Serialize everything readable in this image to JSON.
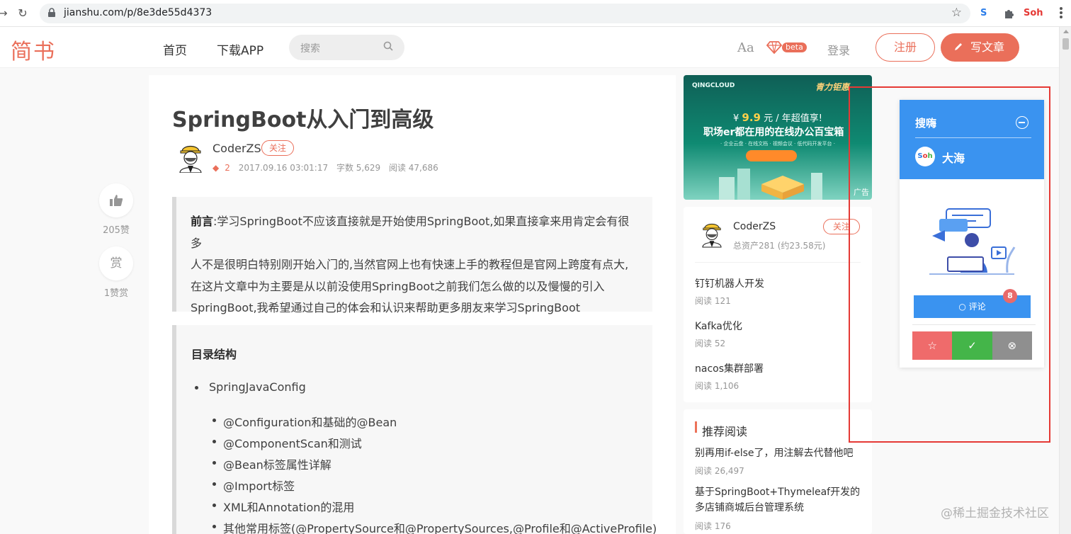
{
  "browser": {
    "url": "jianshu.com/p/8e3de55d4373",
    "ext_label": "Soh"
  },
  "site": {
    "logo": "简书",
    "nav": [
      "首页",
      "下载APP"
    ],
    "search_placeholder": "搜索",
    "aa": "Aa",
    "beta": "beta",
    "login": "登录",
    "signup": "注册",
    "write": "写文章",
    "brand_color": "#ea6f5a"
  },
  "actions": {
    "like_count": "205赞",
    "reward_label": "赏",
    "reward_count": "1赞赏"
  },
  "article": {
    "title": "SpringBoot从入门到高级",
    "author": "CoderZS",
    "follow": "关注",
    "diamonds": "2",
    "date": "2017.09.16 03:01:17",
    "words": "字数 5,629",
    "reads": "阅读 47,686",
    "preface_label": "前言",
    "preface_lines": [
      ":学习SpringBoot不应该直接就是开始使用SpringBoot,如果直接拿来用肯定会有很多",
      "人不是很明白特别刚开始入门的,当然官网上也有快速上手的教程但是官网上跨度有点大,",
      "在这片文章中为主要是从以前没使用SpringBoot之前我们怎么做的以及慢慢的引入",
      "SpringBoot,我希望通过自己的体会和认识来帮助更多朋友来学习SpringBoot"
    ],
    "toc_title": "目录结构",
    "toc_l1": "SpringJavaConfig",
    "toc_l2": [
      "@Configuration和基础的@Bean",
      "@ComponentScan和测试",
      "@Bean标签属性详解",
      "@Import标签",
      "XML和Annotation的混用",
      "其他常用标签(@PropertySource和@PropertySources,@Profile和@ActiveProfile)"
    ]
  },
  "ad": {
    "brand": "QINGCLOUD",
    "brand2": "青力钜惠",
    "price_prefix": "¥",
    "price": "9.9",
    "price_suffix": "元 / 年超值享!",
    "headline": "职场er都在用的在线办公百宝箱",
    "subline": "· 企业云盘 · 在线文档 · 视频会议 · 低代码开发平台 ·",
    "tag": "广告"
  },
  "author_card": {
    "name": "CoderZS",
    "assets": "总资产281 (约23.58元)",
    "follow": "关注",
    "articles": [
      {
        "title": "钉钉机器人开发",
        "read": "阅读 121"
      },
      {
        "title": "Kafka优化",
        "read": "阅读 52"
      },
      {
        "title": "nacos集群部署",
        "read": "阅读 1,106"
      }
    ]
  },
  "recommend": {
    "title": "推荐阅读",
    "items": [
      {
        "title": "别再用if-else了，用注解去代替他吧",
        "read": "阅读 26,497"
      },
      {
        "title": "基于SpringBoot+Thymeleaf开发的多店铺商城后台管理系统",
        "read": "阅读 176"
      }
    ]
  },
  "panel": {
    "title": "搜嗨",
    "user": "大海",
    "comment": "评论",
    "badge": "8",
    "accent": "#3a93f0",
    "action_colors": [
      "#ef6b6b",
      "#44b549",
      "#8f8f8f"
    ]
  },
  "watermark": "@稀土掘金技术社区"
}
